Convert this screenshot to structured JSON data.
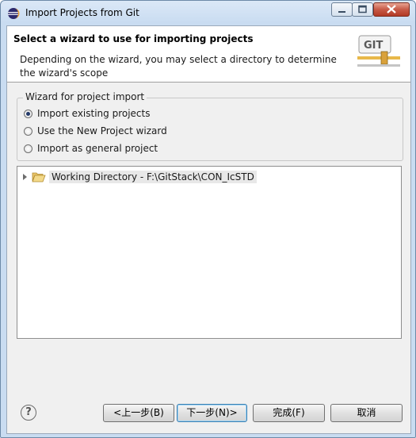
{
  "window": {
    "title": "Import Projects from Git"
  },
  "header": {
    "title": "Select a wizard to use for importing projects",
    "description": "Depending on the wizard, you may select a directory to determine the wizard's scope",
    "logo_text": "GIT"
  },
  "wizard_group": {
    "legend": "Wizard for project import",
    "options": [
      {
        "label": "Import existing projects",
        "selected": true
      },
      {
        "label": "Use the New Project wizard",
        "selected": false
      },
      {
        "label": "Import as general project",
        "selected": false
      }
    ]
  },
  "tree": {
    "items": [
      {
        "label": "Working Directory - F:\\GitStack\\CON_IcSTD",
        "icon": "folder-open-icon",
        "expanded": false
      }
    ]
  },
  "footer": {
    "help_glyph": "?",
    "back_label": "<上一步(B)",
    "next_label": "下一步(N)>",
    "finish_label": "完成(F)",
    "cancel_label": "取消"
  },
  "colors": {
    "titlebar": "#c9dcf1",
    "close_button": "#c75a47",
    "default_button_border": "#3c7fb1"
  }
}
